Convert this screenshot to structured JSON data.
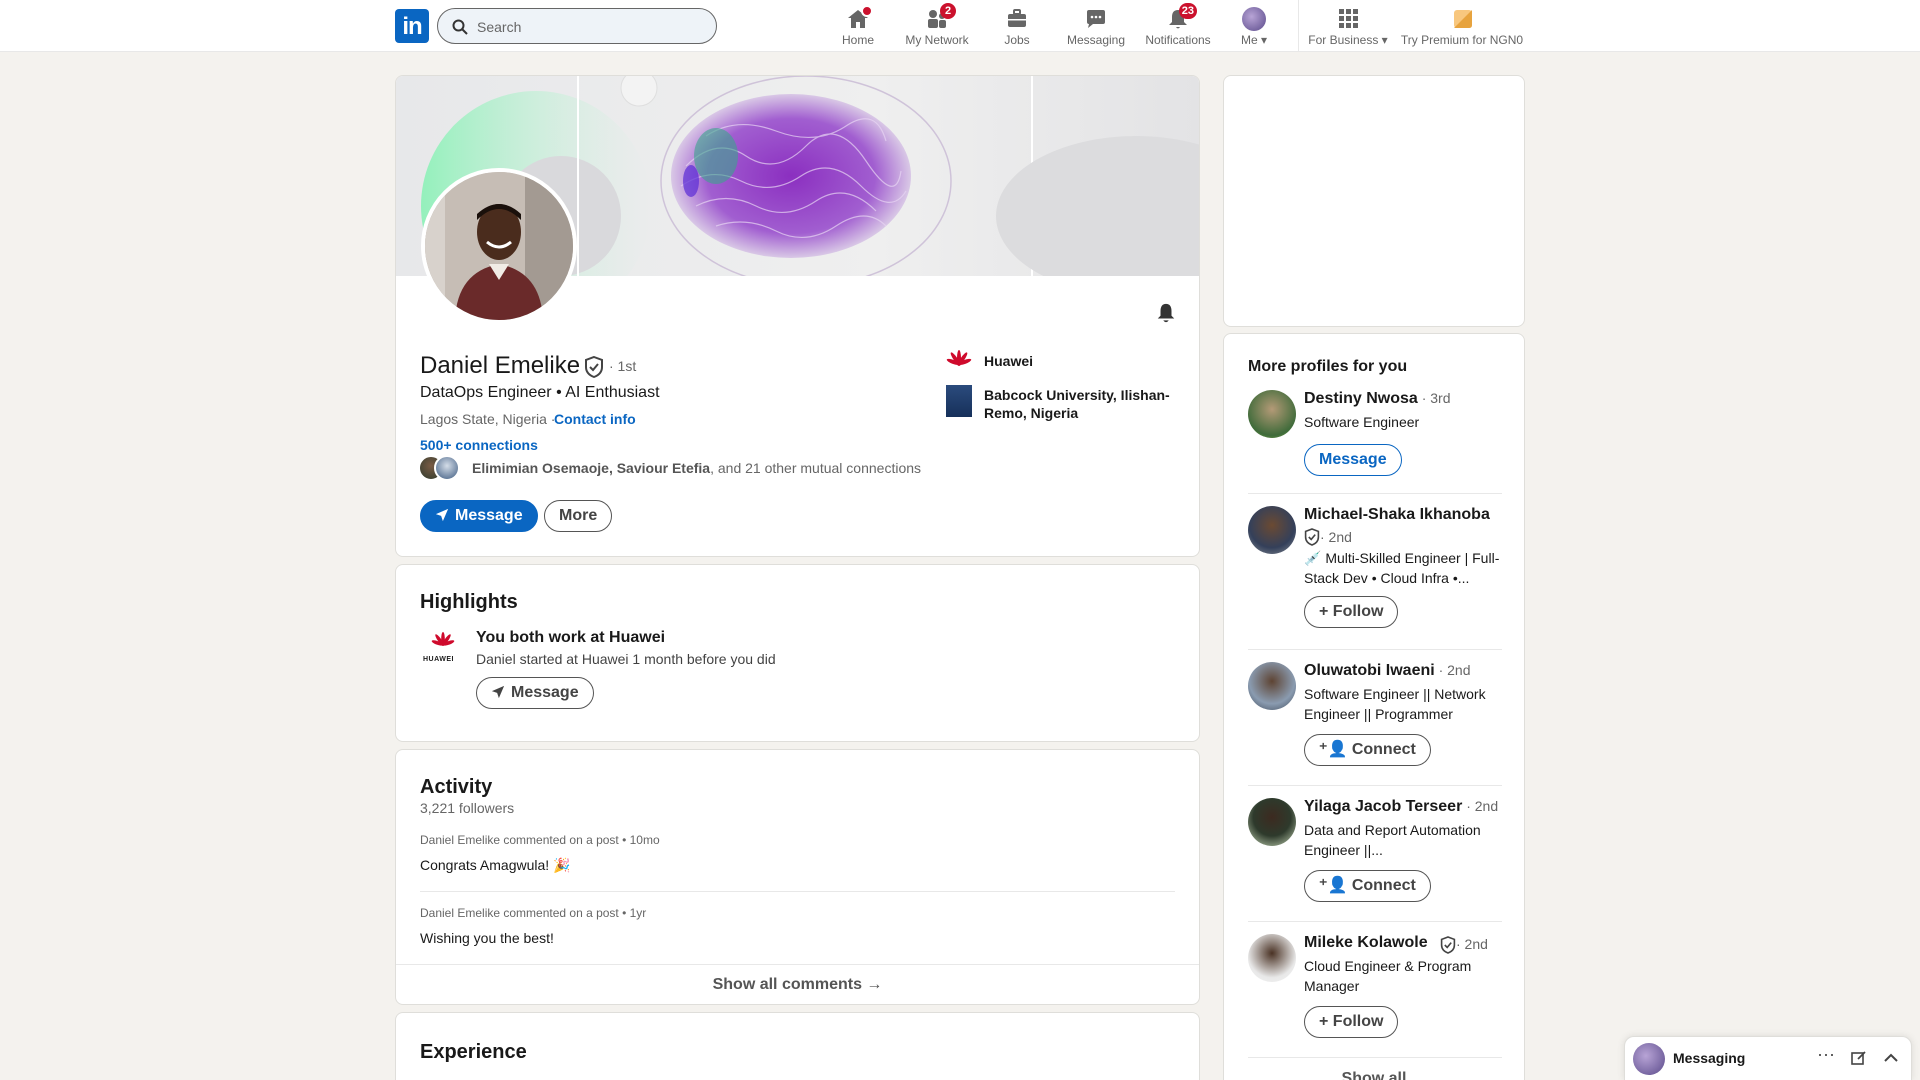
{
  "nav": {
    "search_placeholder": "Search",
    "items": [
      {
        "label": "Home",
        "icon": "home-icon"
      },
      {
        "label": "My Network",
        "icon": "network-icon",
        "badge": "2"
      },
      {
        "label": "Jobs",
        "icon": "jobs-icon"
      },
      {
        "label": "Messaging",
        "icon": "messaging-icon"
      },
      {
        "label": "Notifications",
        "icon": "bell-icon",
        "badge": "23"
      },
      {
        "label": "Me",
        "icon": "me-avatar"
      },
      {
        "label": "For Business",
        "icon": "grid-icon"
      },
      {
        "label": "Try Premium for NGN0",
        "icon": "premium-icon"
      }
    ]
  },
  "profile": {
    "name": "Daniel Emelike",
    "degree": "· 1st",
    "headline": "DataOps Engineer • AI Enthusiast",
    "location": "Lagos State, Nigeria ·",
    "contact_info": "Contact info",
    "connections": "500+ connections",
    "mutual_names": "Elimimian Osemaoje, Saviour Etefia",
    "mutual_rest": ", and 21 other mutual connections",
    "message_button": "Message",
    "more_button": "More",
    "orgs": [
      {
        "name": "Huawei"
      },
      {
        "name": "Babcock University, Ilishan-Remo, Nigeria"
      }
    ]
  },
  "highlights": {
    "title": "Highlights",
    "logo_text": "HUAWEI",
    "heading": "You both work at Huawei",
    "detail": "Daniel started at Huawei 1 month before you did",
    "message_button": "Message"
  },
  "activity": {
    "title": "Activity",
    "followers": "3,221 followers",
    "items": [
      {
        "meta": "Daniel Emelike commented on a post • 10mo",
        "text": "Congrats Amagwula! 🎉"
      },
      {
        "meta": "Daniel Emelike commented on a post • 1yr",
        "text": "Wishing you the best!"
      }
    ],
    "show_all": "Show all comments →"
  },
  "experience": {
    "title": "Experience"
  },
  "more_profiles": {
    "title": "More profiles for you",
    "people": [
      {
        "name": "Destiny Nwosa",
        "degree": " · 3rd",
        "headline": "Software Engineer",
        "action": "Message"
      },
      {
        "name": "Michael-Shaka Ikhanoba",
        "degree": " · 2nd",
        "headline": "💉 Multi-Skilled Engineer | Full-Stack Dev • Cloud Infra •...",
        "action": "Follow"
      },
      {
        "name": "Oluwatobi Iwaeni",
        "degree": " · 2nd",
        "headline": "Software Engineer || Network Engineer || Programmer",
        "action": "Connect"
      },
      {
        "name": "Yilaga Jacob Terseer",
        "degree": " · 2nd",
        "headline": "Data and Report Automation Engineer ||...",
        "action": "Connect"
      },
      {
        "name": "Mileke Kolawole",
        "degree": " · 2nd",
        "headline": "Cloud Engineer & Program Manager",
        "action": "Follow"
      }
    ],
    "show_all": "Show all"
  },
  "messaging_bar": {
    "label": "Messaging"
  },
  "colors": {
    "brand": "#0a66c2",
    "badge": "#cb112d",
    "background": "#f4f2ee"
  }
}
